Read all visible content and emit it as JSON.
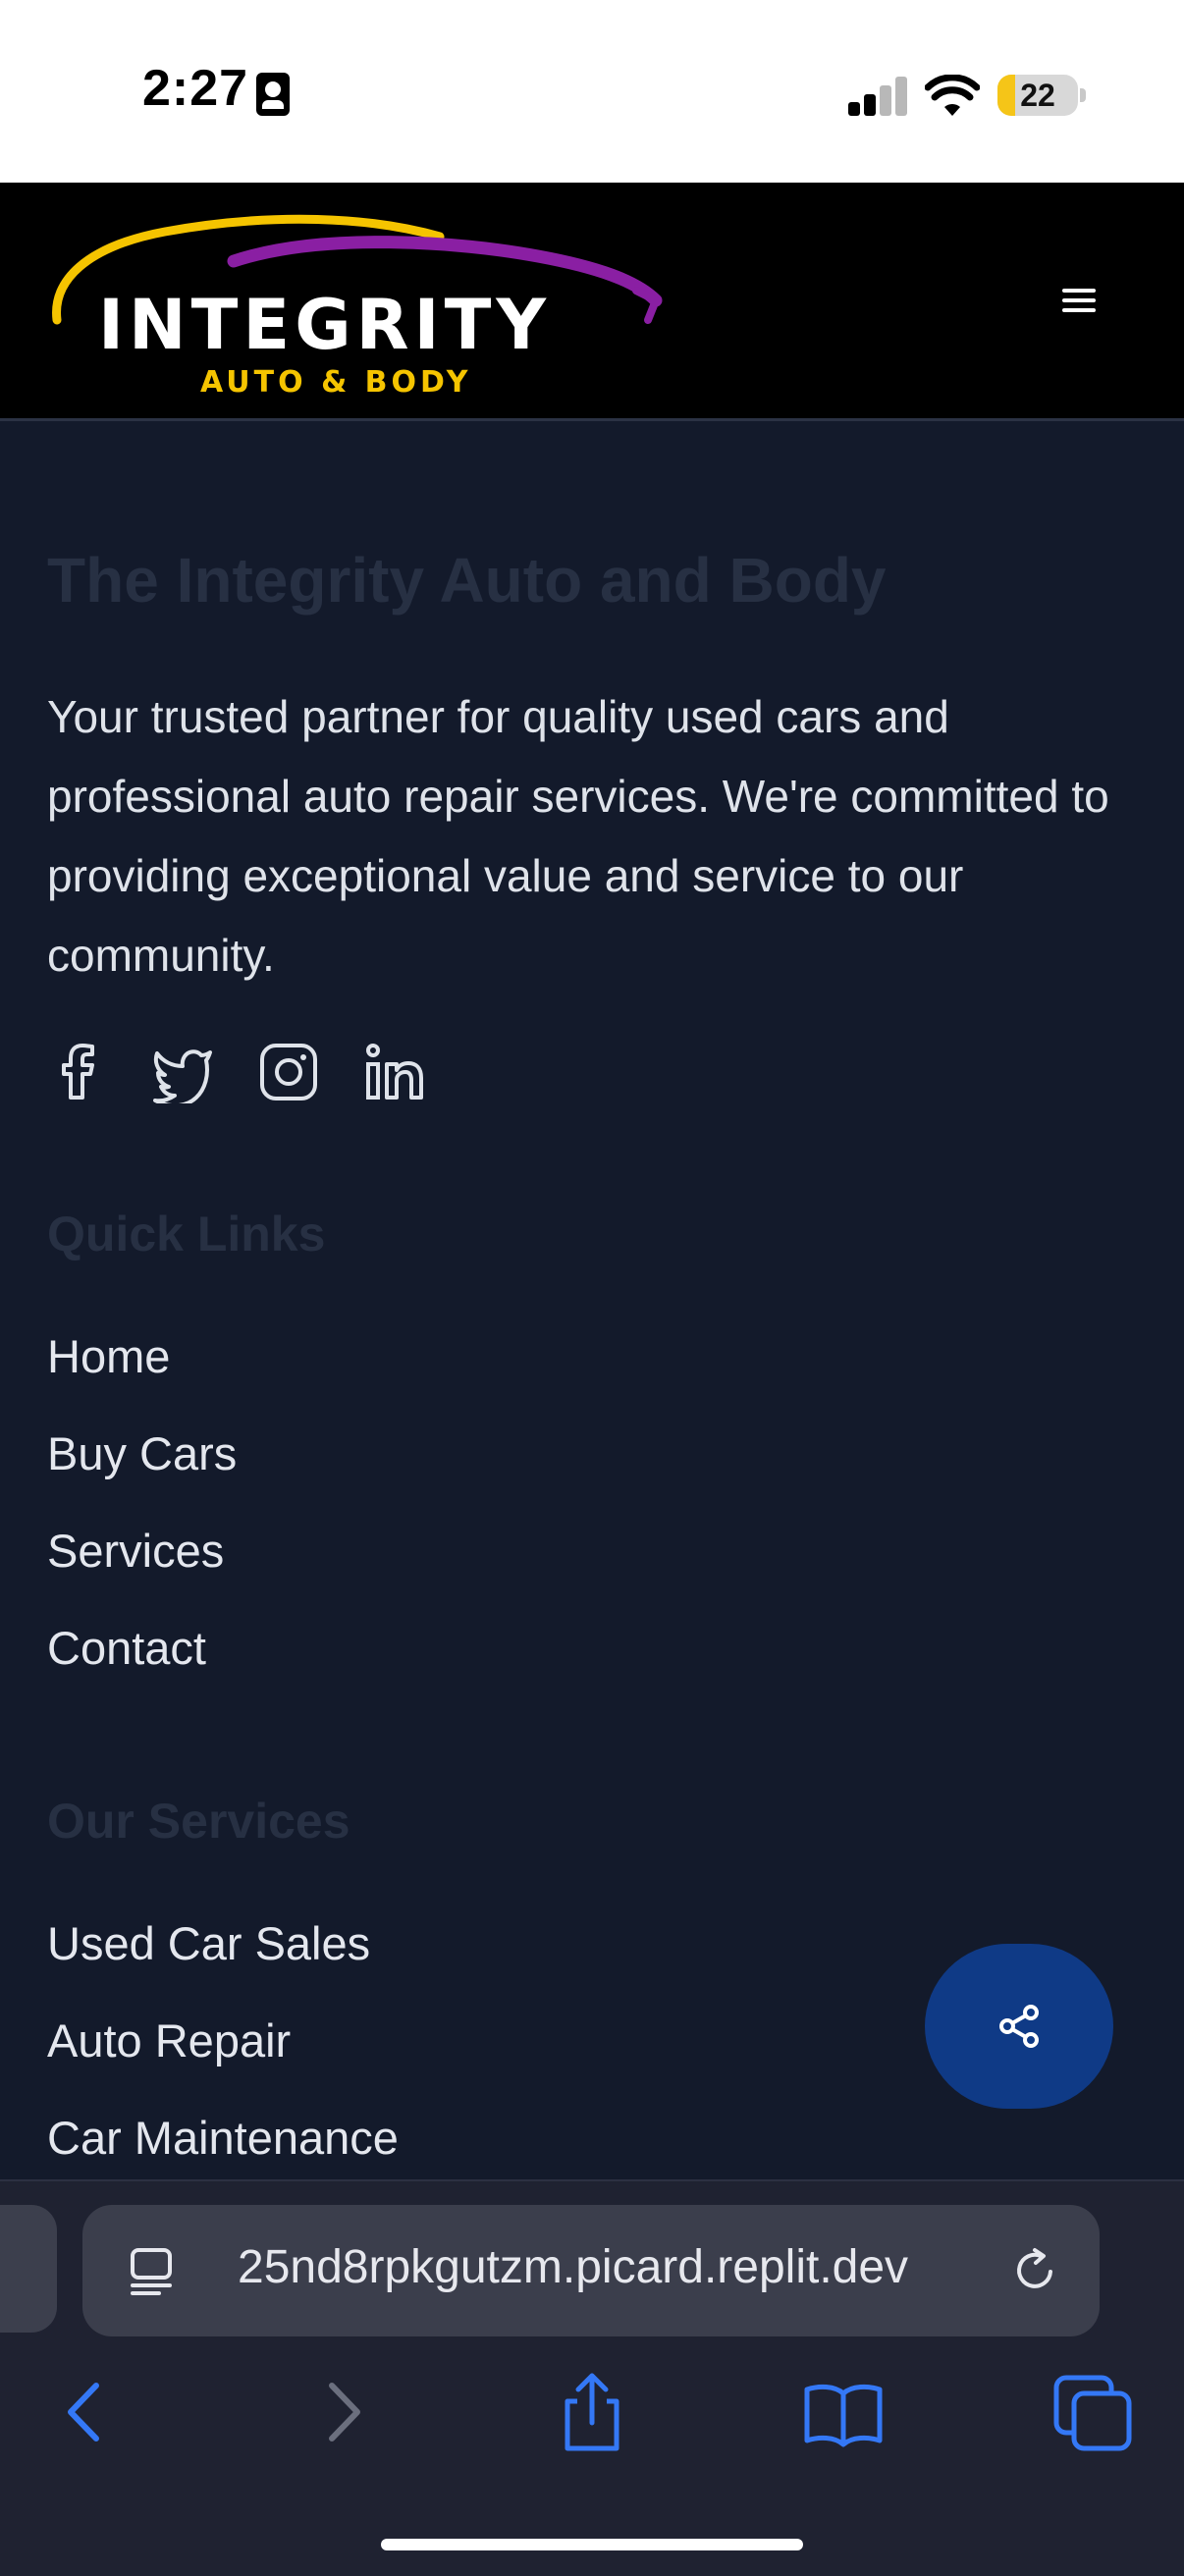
{
  "status_bar": {
    "time": "2:27",
    "battery_level": "22",
    "battery_fraction": 0.22,
    "icons": [
      "id-card-icon",
      "cellular-signal-icon",
      "wifi-icon",
      "battery-icon"
    ]
  },
  "header": {
    "logo_main": "INTEGRITY",
    "logo_sub": "AUTO & BODY",
    "menu_icon": "hamburger-menu-icon"
  },
  "about": {
    "title": "The Integrity Auto and Body",
    "description": "Your trusted partner for quality used cars and professional auto repair services. We're committed to providing exceptional value and service to our community.",
    "social_icons": [
      "facebook-icon",
      "twitter-icon",
      "instagram-icon",
      "linkedin-icon"
    ]
  },
  "quick_links": {
    "title": "Quick Links",
    "items": [
      "Home",
      "Buy Cars",
      "Services",
      "Contact"
    ]
  },
  "services": {
    "title": "Our Services",
    "items": [
      "Used Car Sales",
      "Auto Repair",
      "Car Maintenance"
    ]
  },
  "fab": {
    "icon": "share-icon"
  },
  "browser": {
    "url": "25nd8rpkgutzm.picard.replit.dev",
    "icons": [
      "page-menu-icon",
      "reload-icon",
      "back-icon",
      "forward-icon",
      "share-icon",
      "bookmarks-icon",
      "tabs-icon"
    ]
  },
  "colors": {
    "page_background": "#131a2b",
    "header_background": "#000000",
    "logo_accent_yellow": "#f5c400",
    "logo_accent_purple": "#8a1fa3",
    "fab_background": "#0f3a86",
    "browser_accent": "#3478f6"
  }
}
